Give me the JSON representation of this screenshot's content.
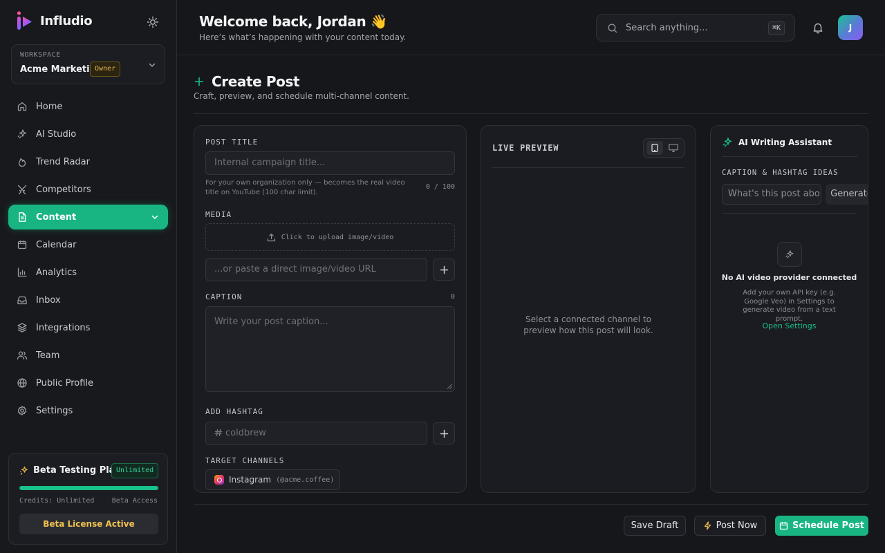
{
  "brand": {
    "name": "Infludio"
  },
  "workspace": {
    "label": "WORKSPACE",
    "name": "Acme Marketing",
    "role": "Owner"
  },
  "sidebar": {
    "items": [
      {
        "label": "Home",
        "icon": "home-icon"
      },
      {
        "label": "AI Studio",
        "icon": "sparkles-icon"
      },
      {
        "label": "Trend Radar",
        "icon": "flame-icon"
      },
      {
        "label": "Competitors",
        "icon": "swords-icon"
      },
      {
        "label": "Content",
        "icon": "document-icon",
        "active": true
      },
      {
        "label": "Calendar",
        "icon": "calendar-icon"
      },
      {
        "label": "Analytics",
        "icon": "bar-chart-icon"
      },
      {
        "label": "Inbox",
        "icon": "inbox-icon"
      },
      {
        "label": "Integrations",
        "icon": "layers-icon"
      },
      {
        "label": "Team",
        "icon": "users-icon"
      },
      {
        "label": "Public Profile",
        "icon": "globe-icon"
      },
      {
        "label": "Settings",
        "icon": "gear-icon"
      }
    ]
  },
  "plan": {
    "title": "Beta Testing Plan",
    "badge": "Unlimited",
    "progress": 1.0,
    "credits": "Credits: Unlimited",
    "access": "Beta Access",
    "button": "Beta License Active"
  },
  "header": {
    "welcome": "Welcome back, Jordan 👋",
    "subtitle": "Here’s what’s happening with your content today.",
    "search_placeholder": "Search anything...",
    "shortcut": "⌘K",
    "avatar_initial": "J"
  },
  "page": {
    "title": "Create Post",
    "subtitle": "Craft, preview, and schedule multi-channel content."
  },
  "form": {
    "title_label": "POST TITLE",
    "title_placeholder": "Internal campaign title...",
    "title_hint": "For your own organization only — becomes the real video title on YouTube (100 char limit).",
    "title_counter": "0 / 100",
    "media_label": "MEDIA",
    "upload_text": "Click to upload image/video",
    "url_placeholder": "...or paste a direct image/video URL",
    "caption_label": "CAPTION",
    "caption_counter": "0",
    "caption_placeholder": "Write your post caption...",
    "hashtag_label": "ADD HASHTAG",
    "hashtag_placeholder": "coldbrew",
    "channels_label": "TARGET CHANNELS",
    "channels": [
      {
        "name": "Instagram",
        "handle": "(@acme.coffee)"
      }
    ]
  },
  "preview": {
    "title": "LIVE PREVIEW",
    "empty": "Select a connected channel to preview how this post will look."
  },
  "assistant": {
    "title": "AI Writing Assistant",
    "ideas_label": "CAPTION & HASHTAG IDEAS",
    "ideas_placeholder": "What's this post about?",
    "generate": "Generate",
    "empty_title": "No AI video provider connected",
    "empty_sub": "Add your own API key (e.g. Google Veo) in Settings to generate video from a text prompt.",
    "settings_link": "Open Settings"
  },
  "actions": {
    "save_draft": "Save Draft",
    "post_now": "Post Now",
    "schedule": "Schedule Post"
  },
  "colors": {
    "accent": "#18b583",
    "warning": "#e8b84a",
    "background": "#16171b"
  }
}
